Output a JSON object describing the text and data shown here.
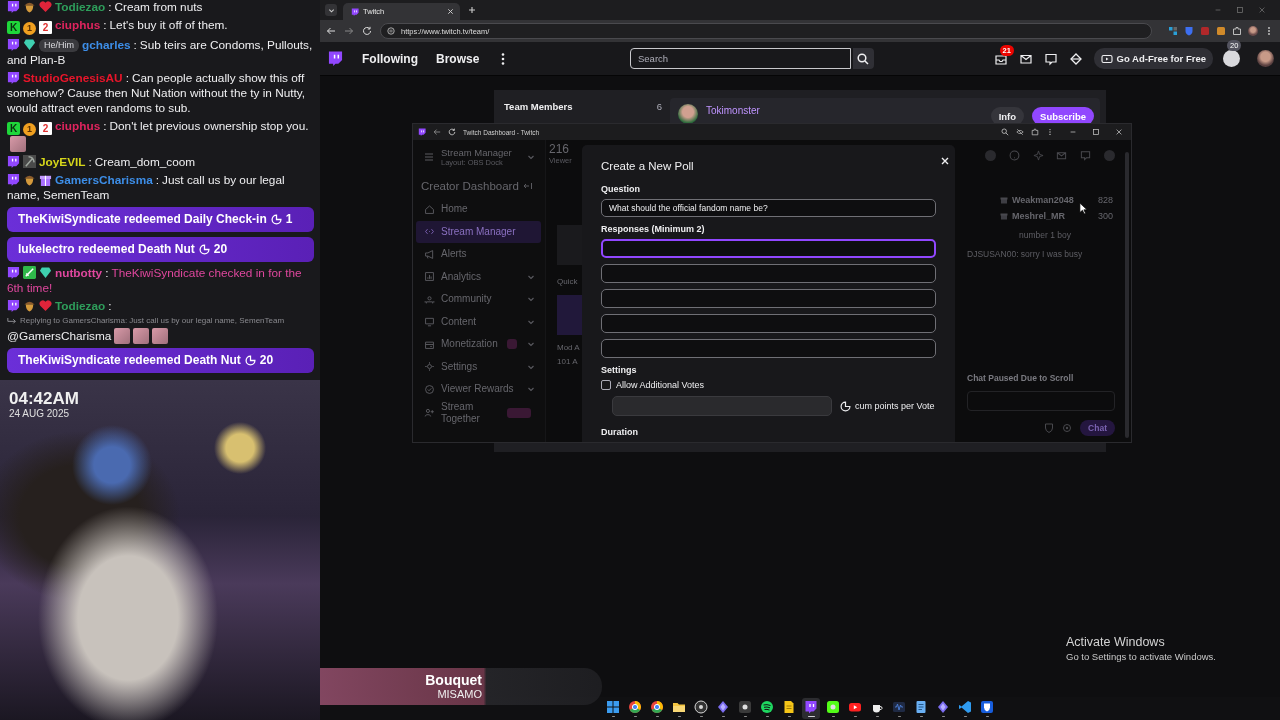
{
  "chat": {
    "messages": [
      {
        "kind": "message",
        "badges": [
          {
            "kind": "prime"
          },
          {
            "kind": "acorn"
          },
          {
            "kind": "heart"
          }
        ],
        "user": "Todiezao",
        "color": "#2e9e5b",
        "separator": ":",
        "text": "Cream from nuts",
        "action": false
      },
      {
        "kind": "message",
        "badges": [
          {
            "kind": "letter",
            "label": "K"
          },
          {
            "kind": "coin",
            "label": "1"
          },
          {
            "kind": "tile",
            "label": "2"
          }
        ],
        "user": "ciuphus",
        "color": "#e0245e",
        "separator": ":",
        "text": "Let's buy it off of them.",
        "action": false
      },
      {
        "kind": "message",
        "badges": [
          {
            "kind": "prime"
          },
          {
            "kind": "gem"
          }
        ],
        "pronoun": "He/Him",
        "user": "gcharles",
        "color": "#3d8ee8",
        "separator": ":",
        "text": "Sub teirs are Condoms, Pullouts, and Plan-B",
        "action": false
      },
      {
        "kind": "message",
        "badges": [
          {
            "kind": "prime"
          }
        ],
        "user": "StudioGenesisAU",
        "color": "#e8152a",
        "separator": ":",
        "text": "Can people actually show this off somehow? Cause then Nut Nation without the ty in Nutty, would attract even randoms to sub.",
        "action": false
      },
      {
        "kind": "message",
        "badges": [
          {
            "kind": "letter",
            "label": "K"
          },
          {
            "kind": "coin",
            "label": "1"
          },
          {
            "kind": "tile",
            "label": "2"
          }
        ],
        "user": "ciuphus",
        "color": "#e0245e",
        "separator": ":",
        "text": "Don't let previous ownership stop you.",
        "emotes": [
          {
            "kind": "face"
          }
        ],
        "action": false
      },
      {
        "kind": "message",
        "badges": [
          {
            "kind": "prime"
          },
          {
            "kind": "pickaxe"
          }
        ],
        "user": "JoyEVIL",
        "color": "#d6d61a",
        "separator": ":",
        "text": "Cream_dom_coom",
        "action": false
      },
      {
        "kind": "message",
        "badges": [
          {
            "kind": "prime"
          },
          {
            "kind": "acorn"
          },
          {
            "kind": "gift"
          }
        ],
        "user": "GamersCharisma",
        "color": "#3d8ee8",
        "separator": ":",
        "text": "Just call us by our legal name, SemenTeam",
        "action": false
      },
      {
        "kind": "redemption",
        "text": "TheKiwiSyndicate redeemed Daily Check-in",
        "cost": "1"
      },
      {
        "kind": "redemption",
        "text": "lukelectro redeemed Death Nut",
        "cost": "20"
      },
      {
        "kind": "message",
        "badges": [
          {
            "kind": "prime"
          },
          {
            "kind": "sword"
          },
          {
            "kind": "gem"
          }
        ],
        "user": "nutbotty",
        "color": "#e0479e",
        "separator": ":",
        "text": "TheKiwiSyndicate checked in for the 6th time!",
        "action": true
      },
      {
        "kind": "message",
        "badges": [
          {
            "kind": "prime"
          },
          {
            "kind": "acorn"
          },
          {
            "kind": "heart"
          }
        ],
        "user": "Todiezao",
        "color": "#2e9e5b",
        "separator": ":",
        "reply": "Replying to GamersCharisma: Just call us by our legal name, SemenTeam",
        "text": "@GamersCharisma",
        "emotes": [
          {
            "kind": "face"
          },
          {
            "kind": "face"
          },
          {
            "kind": "face"
          }
        ],
        "action": false
      },
      {
        "kind": "redemption",
        "text": "TheKiwiSyndicate redeemed Death Nut",
        "cost": "20"
      }
    ]
  },
  "webcam": {
    "clock": "04:42AM",
    "date": "24 AUG 2025"
  },
  "now_playing": {
    "title": "Bouquet",
    "artist": "MISAMO"
  },
  "browser": {
    "tabs": [
      {
        "title": "Twitch",
        "selected": true
      }
    ],
    "url": "https://www.twitch.tv/team/"
  },
  "twitch_nav": {
    "links": [
      "Following",
      "Browse"
    ],
    "search": {
      "placeholder": "Search"
    },
    "inbox_count": "21",
    "ad_free_button": "Go Ad-Free for Free",
    "bits_count": "20"
  },
  "team_panel": {
    "title": "Team Members",
    "count": "6",
    "members": [
      {
        "name": "Tokimonster",
        "info_button": "Info",
        "subscribe_button": "Subscribe"
      }
    ]
  },
  "dashboard_window": {
    "title": "Twitch Dashboard - Twitch",
    "sidebar": {
      "manager_title": "Stream Manager",
      "layout": "Layout: OBS Dock",
      "heading": "Creator Dashboard",
      "items": [
        {
          "label": "Home",
          "selected": false,
          "expandable": false,
          "flagged": false
        },
        {
          "label": "Stream Manager",
          "selected": true,
          "expandable": false,
          "flagged": false
        },
        {
          "label": "Alerts",
          "selected": false,
          "expandable": false,
          "flagged": false
        },
        {
          "label": "Analytics",
          "selected": false,
          "expandable": true,
          "flagged": false
        },
        {
          "label": "Community",
          "selected": false,
          "expandable": true,
          "flagged": false
        },
        {
          "label": "Content",
          "selected": false,
          "expandable": true,
          "flagged": false
        },
        {
          "label": "Monetization",
          "selected": false,
          "expandable": true,
          "flagged": true
        },
        {
          "label": "Settings",
          "selected": false,
          "expandable": true,
          "flagged": false
        },
        {
          "label": "Viewer Rewards",
          "selected": false,
          "expandable": true,
          "flagged": false
        },
        {
          "label": "Stream Together",
          "selected": false,
          "expandable": false,
          "flagged": true
        }
      ]
    },
    "stream_column": {
      "viewers": "216",
      "viewers_label": "Viewer",
      "texts": [
        "Quick",
        "Mod A",
        "101 A"
      ]
    },
    "poll": {
      "title": "Create a New Poll",
      "question_label": "Question",
      "question": "What should the official fandom name be?",
      "responses_label": "Responses (Minimum 2)",
      "responses": [
        {
          "focused": true
        },
        {
          "focused": false
        },
        {
          "focused": false
        },
        {
          "focused": false
        },
        {
          "focused": false
        }
      ],
      "settings_label": "Settings",
      "allow_additional_votes": {
        "label": "Allow Additional Votes",
        "checked": false
      },
      "points_suffix": "cum points per Vote",
      "duration_label": "Duration"
    },
    "chat": {
      "leaders": [
        {
          "user": "Weakman2048",
          "score": "828"
        },
        {
          "user": "Meshrel_MR",
          "score": "300"
        }
      ],
      "lines": [
        "number 1 boy",
        "DJSUSAN00: sorry I was busy"
      ],
      "paused_notice": "Chat Paused Due to Scroll",
      "send_button": "Chat"
    }
  },
  "desktop": {
    "activation_title": "Activate Windows",
    "activation_hint": "Go to Settings to activate Windows."
  },
  "taskbar": {
    "apps": [
      {
        "selected": false
      },
      {
        "selected": false
      },
      {
        "selected": false
      },
      {
        "selected": false
      },
      {
        "selected": false
      },
      {
        "selected": false
      },
      {
        "selected": false
      },
      {
        "selected": false
      },
      {
        "selected": false
      },
      {
        "selected": true
      },
      {
        "selected": false
      },
      {
        "selected": false
      },
      {
        "selected": false
      },
      {
        "selected": false
      },
      {
        "selected": false
      },
      {
        "selected": false
      },
      {
        "selected": false
      },
      {
        "selected": false
      }
    ]
  }
}
